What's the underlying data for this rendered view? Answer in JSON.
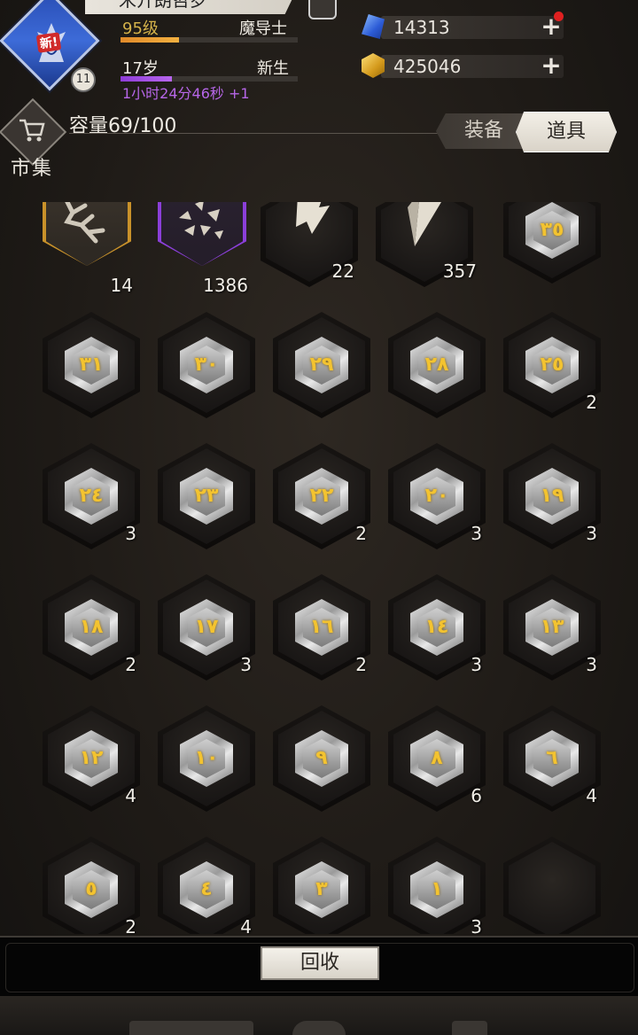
{
  "player": {
    "name": "米开朗哲罗",
    "level_label": "95级",
    "class_label": "魔导士",
    "level_progress": 0.33,
    "age_label": "17岁",
    "stage_label": "新生",
    "age_progress": 0.29,
    "timer_label": "1小时24分46秒 +1",
    "avatar_badge": "11",
    "new_tag": "新!"
  },
  "currencies": {
    "gems": "14313",
    "gold": "425046"
  },
  "market": {
    "label": "市集"
  },
  "capacity_label": "容量69/100",
  "tabs": {
    "equipment": "装备",
    "items": "道具"
  },
  "colors": {
    "accent_gold": "#f3c330",
    "rarity_orange": "#c8912a",
    "rarity_purple": "#8b3fd9",
    "gem_blue": "#2c5bd6",
    "gold_coin": "#d49a1c"
  },
  "top_items": [
    {
      "name": "antler-item-icon",
      "count": "14"
    },
    {
      "name": "shards-item-icon",
      "count": "1386"
    },
    {
      "name": "claw-item-icon",
      "count": "22"
    },
    {
      "name": "crystal-item-icon",
      "count": "357"
    }
  ],
  "rune_rows": [
    [
      {
        "glyph": "٣٥",
        "count": ""
      }
    ],
    [
      {
        "glyph": "٣١",
        "count": ""
      },
      {
        "glyph": "٣٠",
        "count": ""
      },
      {
        "glyph": "٢٩",
        "count": ""
      },
      {
        "glyph": "٢٨",
        "count": ""
      },
      {
        "glyph": "٢٥",
        "count": "2"
      }
    ],
    [
      {
        "glyph": "٢٤",
        "count": "3"
      },
      {
        "glyph": "٢٣",
        "count": ""
      },
      {
        "glyph": "٢٢",
        "count": "2"
      },
      {
        "glyph": "٢٠",
        "count": "3"
      },
      {
        "glyph": "١٩",
        "count": "3"
      }
    ],
    [
      {
        "glyph": "١٨",
        "count": "2"
      },
      {
        "glyph": "١٧",
        "count": "3"
      },
      {
        "glyph": "١٦",
        "count": "2"
      },
      {
        "glyph": "١٤",
        "count": "3"
      },
      {
        "glyph": "١٣",
        "count": "3"
      }
    ],
    [
      {
        "glyph": "١٢",
        "count": "4"
      },
      {
        "glyph": "١٠",
        "count": ""
      },
      {
        "glyph": "٩",
        "count": ""
      },
      {
        "glyph": "٨",
        "count": "6"
      },
      {
        "glyph": "٦",
        "count": "4"
      }
    ],
    [
      {
        "glyph": "٥",
        "count": "2"
      },
      {
        "glyph": "٤",
        "count": "4"
      },
      {
        "glyph": "٣",
        "count": ""
      },
      {
        "glyph": "١",
        "count": "3"
      }
    ]
  ],
  "footer": {
    "recycle_label": "回收"
  }
}
